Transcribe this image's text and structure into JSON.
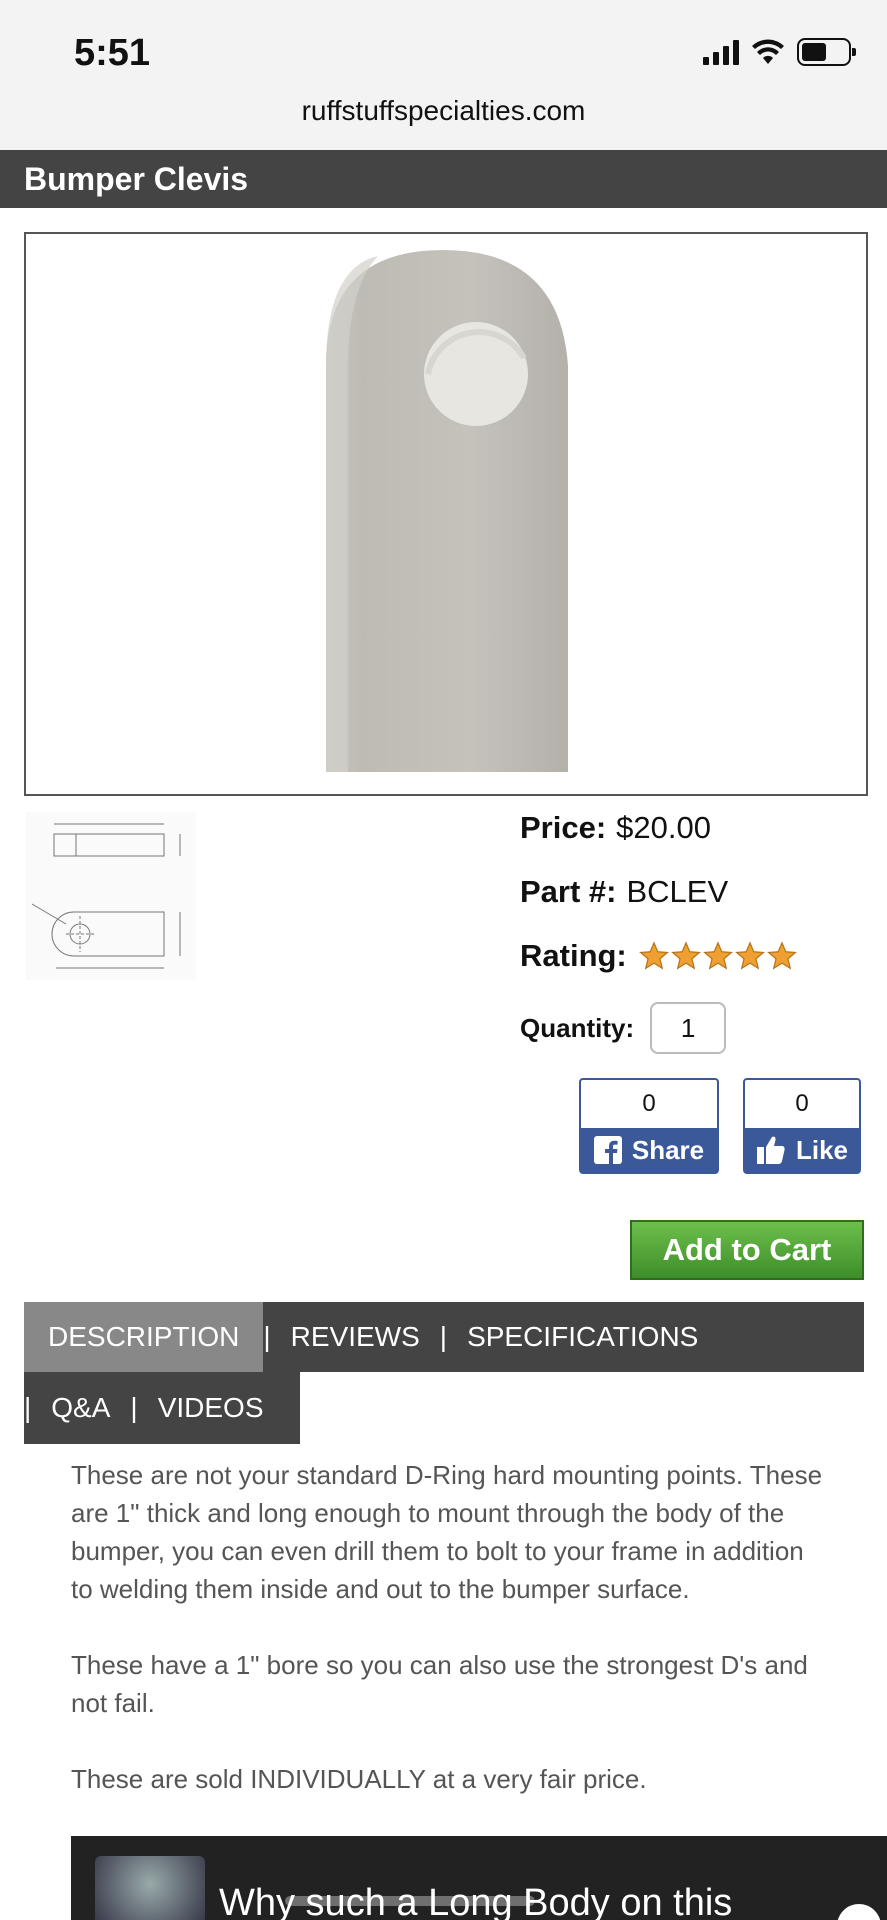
{
  "status_bar": {
    "time": "5:51",
    "url": "ruffstuffspecialties.com"
  },
  "page": {
    "title": "Bumper Clevis"
  },
  "product": {
    "price_label": "Price:",
    "price": "$20.00",
    "part_label": "Part #:",
    "part_number": "BCLEV",
    "rating_label": "Rating:",
    "rating": 5,
    "rating_max": 5,
    "quantity_label": "Quantity:",
    "quantity": "1"
  },
  "social": {
    "share": {
      "count": "0",
      "label": "Share"
    },
    "like": {
      "count": "0",
      "label": "Like"
    }
  },
  "add_to_cart_label": "Add to Cart",
  "tabs": [
    {
      "label": "DESCRIPTION"
    },
    {
      "label": "REVIEWS"
    },
    {
      "label": "SPECIFICATIONS"
    },
    {
      "label": "Q&A"
    },
    {
      "label": "VIDEOS"
    }
  ],
  "tab_separator": "|",
  "description": {
    "p1": "These are not your standard D-Ring hard mounting points. These are 1\" thick and long enough to mount through the body of the bumper, you can even drill them to bolt to your frame in addition to welding them inside and out to the bumper surface.",
    "p2": "These have a 1\" bore so you can also use the strongest D's and not fail.",
    "p3": "These are sold INDIVIDUALLY at a very fair price."
  },
  "video": {
    "title": "Why such a Long Body on this"
  },
  "colors": {
    "title_bar": "#444444",
    "active_tab": "#888888",
    "facebook": "#3b5998",
    "cart_green": "#4fa63a",
    "star": "#f0a030"
  }
}
